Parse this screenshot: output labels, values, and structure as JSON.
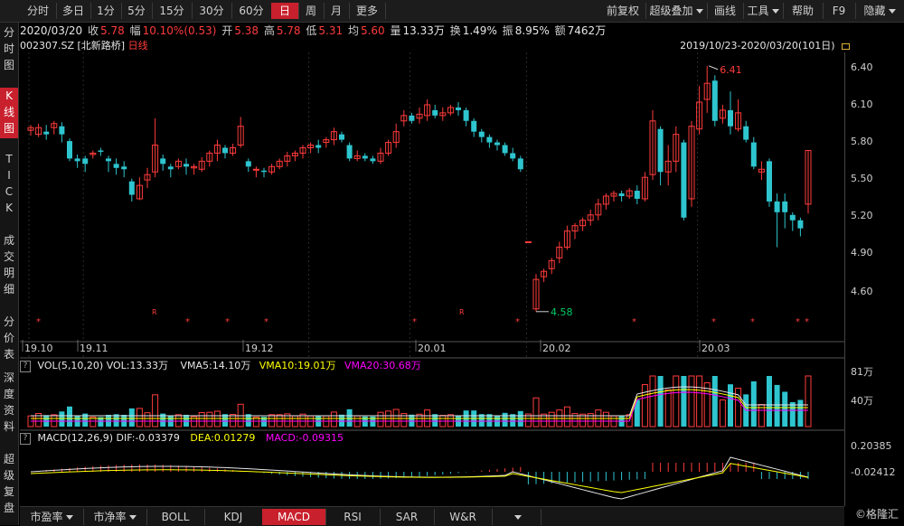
{
  "toolbar": {
    "periods": [
      "分时",
      "多日",
      "1分",
      "5分",
      "15分",
      "30分",
      "60分",
      "日",
      "周",
      "月",
      "更多"
    ],
    "active_period": "日",
    "tools": [
      "前复权",
      "超级叠加",
      "画线",
      "工具",
      "帮助",
      "F9",
      "隐藏"
    ]
  },
  "left_nav": {
    "items": [
      {
        "label": "分时图",
        "active": false
      },
      {
        "label": "K线图",
        "active": true
      },
      {
        "label": "TICK",
        "active": false
      },
      {
        "label": "成交明细",
        "active": false
      },
      {
        "label": "分价表",
        "active": false
      },
      {
        "label": "深度资料",
        "active": false
      },
      {
        "label": "超级复盘",
        "active": false
      }
    ]
  },
  "quote": {
    "date": "2020/03/20",
    "close_label": "收",
    "close": "5.78",
    "change_label": "幅",
    "change": "10.10%(0.53)",
    "open_label": "开",
    "open": "5.38",
    "high_label": "高",
    "high": "5.78",
    "low_label": "低",
    "low": "5.31",
    "avg_label": "均",
    "avg": "5.60",
    "volume_label": "量",
    "volume": "13.33万",
    "turnover_label": "换",
    "turnover": "1.49%",
    "amplitude_label": "振",
    "amplitude": "8.95%",
    "amount_label": "额",
    "amount": "7462万"
  },
  "stock": {
    "code": "002307.SZ",
    "name": "[北新路桥]",
    "period": "日线",
    "range": "2019/10/23-2020/03/20(101日)"
  },
  "price_axis": [
    "6.40",
    "6.10",
    "5.80",
    "5.50",
    "5.20",
    "4.90",
    "4.60"
  ],
  "date_axis": [
    "19.10",
    "19.11",
    "19.12",
    "20.01",
    "20.02",
    "20.03"
  ],
  "annotations": {
    "high": "6.41",
    "low": "4.58"
  },
  "vol_indicator": {
    "name": "VOL(5,10,20)",
    "vol": "VOL:13.33万",
    "vma5": "VMA5:14.10万",
    "vma10": "VMA10:19.01万",
    "vma20": "VMA20:30.68万",
    "axis": [
      "81万",
      "40万"
    ]
  },
  "macd_indicator": {
    "name": "MACD(12,26,9)",
    "dif": "DIF:-0.03379",
    "dea": "DEA:0.01279",
    "macd": "MACD:-0.09315",
    "axis": [
      "0.20385",
      "-0.02412"
    ]
  },
  "bottom_tabs": [
    "市盈率",
    "市净率",
    "BOLL",
    "KDJ",
    "MACD",
    "RSI",
    "SAR",
    "W&R"
  ],
  "active_tab": "MACD",
  "watermark": "©格隆汇",
  "colors": {
    "up": "#ff3b3b",
    "down": "#2ec5cf",
    "accent": "#c8202c",
    "vma10": "#ffff00",
    "vma20": "#ff00ff"
  },
  "chart_data": {
    "type": "candlestick",
    "note_x_range": "2019/10/23-2020/03/20",
    "candles": [
      [
        5.93,
        5.95,
        5.89,
        5.97
      ],
      [
        5.9,
        5.95,
        5.88,
        5.98
      ],
      [
        5.92,
        5.9,
        5.86,
        5.97
      ],
      [
        5.95,
        5.98,
        5.9,
        6.0
      ],
      [
        5.96,
        5.9,
        5.84,
        5.99
      ],
      [
        5.85,
        5.72,
        5.7,
        5.87
      ],
      [
        5.72,
        5.7,
        5.65,
        5.75
      ],
      [
        5.72,
        5.68,
        5.62,
        5.74
      ],
      [
        5.75,
        5.76,
        5.72,
        5.78
      ],
      [
        5.78,
        5.77,
        5.74,
        5.8
      ],
      [
        5.72,
        5.7,
        5.62,
        5.74
      ],
      [
        5.68,
        5.65,
        5.6,
        5.72
      ],
      [
        5.66,
        5.64,
        5.58,
        5.7
      ],
      [
        5.55,
        5.45,
        5.4,
        5.57
      ],
      [
        5.42,
        5.52,
        5.41,
        5.58
      ],
      [
        5.56,
        5.6,
        5.5,
        5.65
      ],
      [
        5.62,
        5.82,
        5.58,
        6.02
      ],
      [
        5.72,
        5.68,
        5.63,
        5.75
      ],
      [
        5.66,
        5.64,
        5.58,
        5.68
      ],
      [
        5.66,
        5.7,
        5.64,
        5.72
      ],
      [
        5.68,
        5.66,
        5.6,
        5.72
      ],
      [
        5.65,
        5.66,
        5.6,
        5.68
      ],
      [
        5.64,
        5.7,
        5.62,
        5.73
      ],
      [
        5.7,
        5.76,
        5.66,
        5.78
      ],
      [
        5.76,
        5.82,
        5.7,
        5.86
      ],
      [
        5.8,
        5.76,
        5.72,
        5.82
      ],
      [
        5.76,
        5.8,
        5.74,
        5.83
      ],
      [
        5.82,
        5.96,
        5.8,
        6.03
      ],
      [
        5.7,
        5.66,
        5.62,
        5.72
      ],
      [
        5.64,
        5.64,
        5.58,
        5.66
      ],
      [
        5.63,
        5.62,
        5.58,
        5.65
      ],
      [
        5.62,
        5.66,
        5.6,
        5.68
      ],
      [
        5.66,
        5.7,
        5.64,
        5.72
      ],
      [
        5.7,
        5.74,
        5.66,
        5.77
      ],
      [
        5.74,
        5.76,
        5.7,
        5.78
      ],
      [
        5.76,
        5.8,
        5.72,
        5.82
      ],
      [
        5.8,
        5.82,
        5.76,
        5.84
      ],
      [
        5.82,
        5.8,
        5.76,
        5.86
      ],
      [
        5.84,
        5.86,
        5.8,
        5.88
      ],
      [
        5.86,
        5.92,
        5.82,
        5.95
      ],
      [
        5.9,
        5.86,
        5.84,
        5.92
      ],
      [
        5.82,
        5.72,
        5.7,
        5.84
      ],
      [
        5.72,
        5.74,
        5.7,
        5.78
      ],
      [
        5.74,
        5.72,
        5.7,
        5.76
      ],
      [
        5.72,
        5.7,
        5.68,
        5.74
      ],
      [
        5.7,
        5.76,
        5.68,
        5.8
      ],
      [
        5.76,
        5.84,
        5.74,
        5.86
      ],
      [
        5.84,
        5.92,
        5.8,
        5.98
      ],
      [
        6.0,
        6.04,
        5.96,
        6.08
      ],
      [
        6.04,
        6.0,
        5.98,
        6.06
      ],
      [
        6.02,
        6.05,
        5.98,
        6.1
      ],
      [
        6.04,
        6.12,
        6.0,
        6.16
      ],
      [
        6.08,
        6.04,
        6.02,
        6.12
      ],
      [
        6.04,
        6.06,
        6.0,
        6.1
      ],
      [
        6.06,
        6.1,
        6.04,
        6.12
      ],
      [
        6.1,
        6.08,
        6.04,
        6.14
      ],
      [
        6.08,
        6.0,
        5.96,
        6.1
      ],
      [
        6.0,
        5.92,
        5.88,
        6.02
      ],
      [
        5.92,
        5.88,
        5.84,
        5.94
      ],
      [
        5.88,
        5.84,
        5.8,
        5.9
      ],
      [
        5.84,
        5.82,
        5.78,
        5.86
      ],
      [
        5.82,
        5.76,
        5.74,
        5.84
      ],
      [
        5.76,
        5.72,
        5.7,
        5.8
      ],
      [
        5.72,
        5.64,
        5.62,
        5.74
      ],
      [
        5.1,
        5.1,
        5.1,
        5.1
      ],
      [
        4.6,
        4.82,
        4.58,
        4.86
      ],
      [
        4.84,
        4.88,
        4.8,
        4.9
      ],
      [
        4.9,
        4.96,
        4.86,
        4.98
      ],
      [
        4.98,
        5.06,
        4.94,
        5.1
      ],
      [
        5.06,
        5.18,
        5.04,
        5.22
      ],
      [
        5.18,
        5.22,
        5.12,
        5.24
      ],
      [
        5.22,
        5.26,
        5.18,
        5.28
      ],
      [
        5.26,
        5.3,
        5.22,
        5.34
      ],
      [
        5.3,
        5.38,
        5.26,
        5.42
      ],
      [
        5.38,
        5.44,
        5.34,
        5.46
      ],
      [
        5.44,
        5.46,
        5.4,
        5.48
      ],
      [
        5.46,
        5.44,
        5.4,
        5.48
      ],
      [
        5.44,
        5.48,
        5.42,
        5.5
      ],
      [
        5.48,
        5.42,
        5.38,
        5.52
      ],
      [
        5.42,
        5.58,
        5.4,
        5.62
      ],
      [
        5.6,
        6.0,
        5.56,
        6.08
      ],
      [
        5.94,
        5.62,
        5.52,
        5.96
      ],
      [
        5.62,
        5.7,
        5.52,
        5.82
      ],
      [
        5.7,
        5.9,
        5.62,
        5.96
      ],
      [
        5.84,
        5.28,
        5.26,
        5.86
      ],
      [
        5.42,
        5.96,
        5.36,
        6.0
      ],
      [
        5.94,
        6.14,
        5.9,
        6.26
      ],
      [
        6.16,
        6.28,
        6.06,
        6.41
      ],
      [
        6.3,
        6.0,
        5.96,
        6.34
      ],
      [
        6.02,
        6.08,
        5.98,
        6.12
      ],
      [
        6.08,
        5.96,
        5.9,
        6.22
      ],
      [
        5.94,
        6.06,
        5.92,
        6.16
      ],
      [
        5.96,
        5.86,
        5.84,
        6.0
      ],
      [
        5.84,
        5.66,
        5.64,
        5.88
      ],
      [
        5.62,
        5.64,
        5.56,
        5.7
      ],
      [
        5.7,
        5.4,
        5.36,
        5.72
      ],
      [
        5.4,
        5.32,
        5.06,
        5.46
      ],
      [
        5.4,
        5.32,
        5.2,
        5.46
      ],
      [
        5.3,
        5.26,
        5.18,
        5.32
      ],
      [
        5.26,
        5.2,
        5.14,
        5.28
      ],
      [
        5.38,
        5.78,
        5.31,
        5.78
      ]
    ]
  }
}
